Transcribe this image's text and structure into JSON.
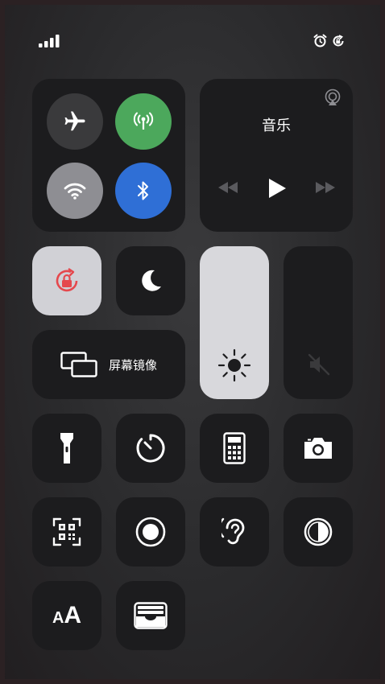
{
  "status_bar": {
    "signal_bars": 4,
    "alarm_icon": "alarm-icon",
    "rotation_lock_icon": "rotation-lock-small-icon"
  },
  "connectivity": {
    "airplane": {
      "icon": "airplane-icon",
      "active": false
    },
    "cellular": {
      "icon": "cellular-antenna-icon",
      "active": true,
      "color": "#4ca85c"
    },
    "wifi": {
      "icon": "wifi-icon",
      "active": true,
      "color": "#8e8e93"
    },
    "bluetooth": {
      "icon": "bluetooth-icon",
      "active": true,
      "color": "#2f6fd6"
    }
  },
  "music": {
    "title": "音乐",
    "airplay_icon": "airplay-icon",
    "controls": [
      "rewind-icon",
      "play-icon",
      "fast-forward-icon"
    ]
  },
  "screen_mirroring": {
    "label": "屏幕镜像",
    "icon": "screen-mirroring-icon"
  },
  "toggles": {
    "rotation_lock": {
      "icon": "rotation-lock-icon",
      "active": true,
      "color": "#e5484d"
    },
    "do_not_disturb": {
      "icon": "moon-icon",
      "active": false
    }
  },
  "sliders": {
    "brightness": {
      "icon": "sun-icon",
      "level": 1.0
    },
    "volume": {
      "icon": "mute-icon",
      "level": 0.0
    }
  },
  "shortcuts": [
    {
      "icon": "flashlight-icon"
    },
    {
      "icon": "timer-icon"
    },
    {
      "icon": "calculator-icon"
    },
    {
      "icon": "camera-icon"
    },
    {
      "icon": "qr-scanner-icon"
    },
    {
      "icon": "screen-record-icon"
    },
    {
      "icon": "hearing-icon"
    },
    {
      "icon": "dark-mode-icon"
    },
    {
      "icon": "text-size-icon",
      "label": "AA"
    },
    {
      "icon": "wallet-icon"
    }
  ]
}
